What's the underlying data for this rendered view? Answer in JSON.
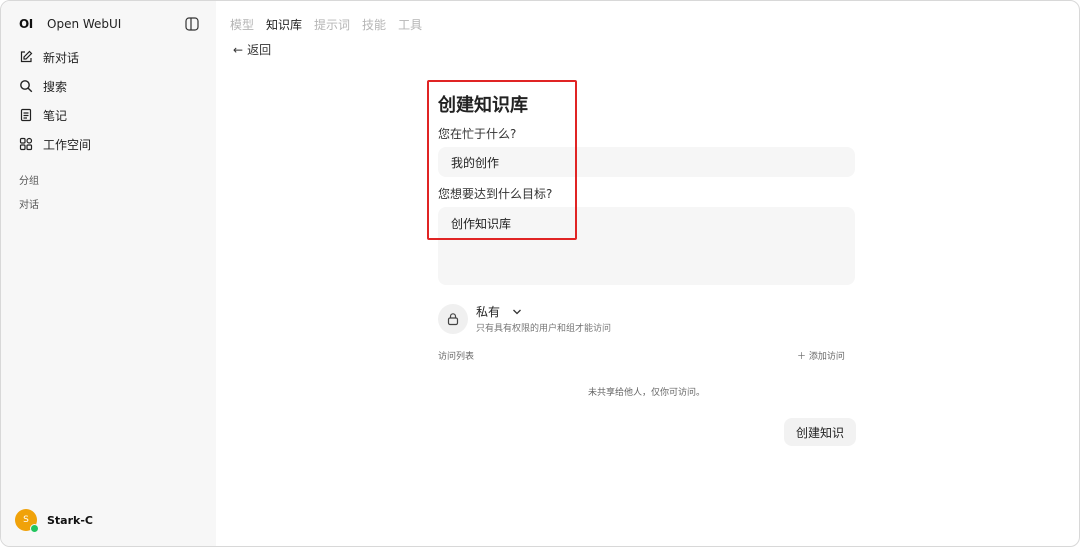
{
  "app": {
    "logo": "OI",
    "name": "Open WebUI"
  },
  "sidebar": {
    "items": [
      {
        "label": "新对话",
        "icon": "edit-icon"
      },
      {
        "label": "搜索",
        "icon": "search-icon"
      },
      {
        "label": "笔记",
        "icon": "note-icon"
      },
      {
        "label": "工作空间",
        "icon": "workspace-icon"
      }
    ],
    "sections": [
      "分组",
      "对话"
    ],
    "user": {
      "initial": "S",
      "name": "Stark-C"
    }
  },
  "tabs": [
    "模型",
    "知识库",
    "提示词",
    "技能",
    "工具"
  ],
  "active_tab": "知识库",
  "back_label": "返回",
  "form": {
    "title": "创建知识库",
    "question1": "您在忙于什么?",
    "name_value": "我的创作",
    "question2": "您想要达到什么目标?",
    "description_value": "创作知识库"
  },
  "access": {
    "mode": "私有",
    "description": "只有具有权限的用户和组才能访问",
    "list_label": "访问列表",
    "add_label": "添加访问",
    "empty_note": "未共享给他人，仅你可访问。"
  },
  "create_button": "创建知识",
  "colors": {
    "highlight": "#e02424",
    "avatar": "#f0a20a",
    "online": "#22c55e"
  }
}
